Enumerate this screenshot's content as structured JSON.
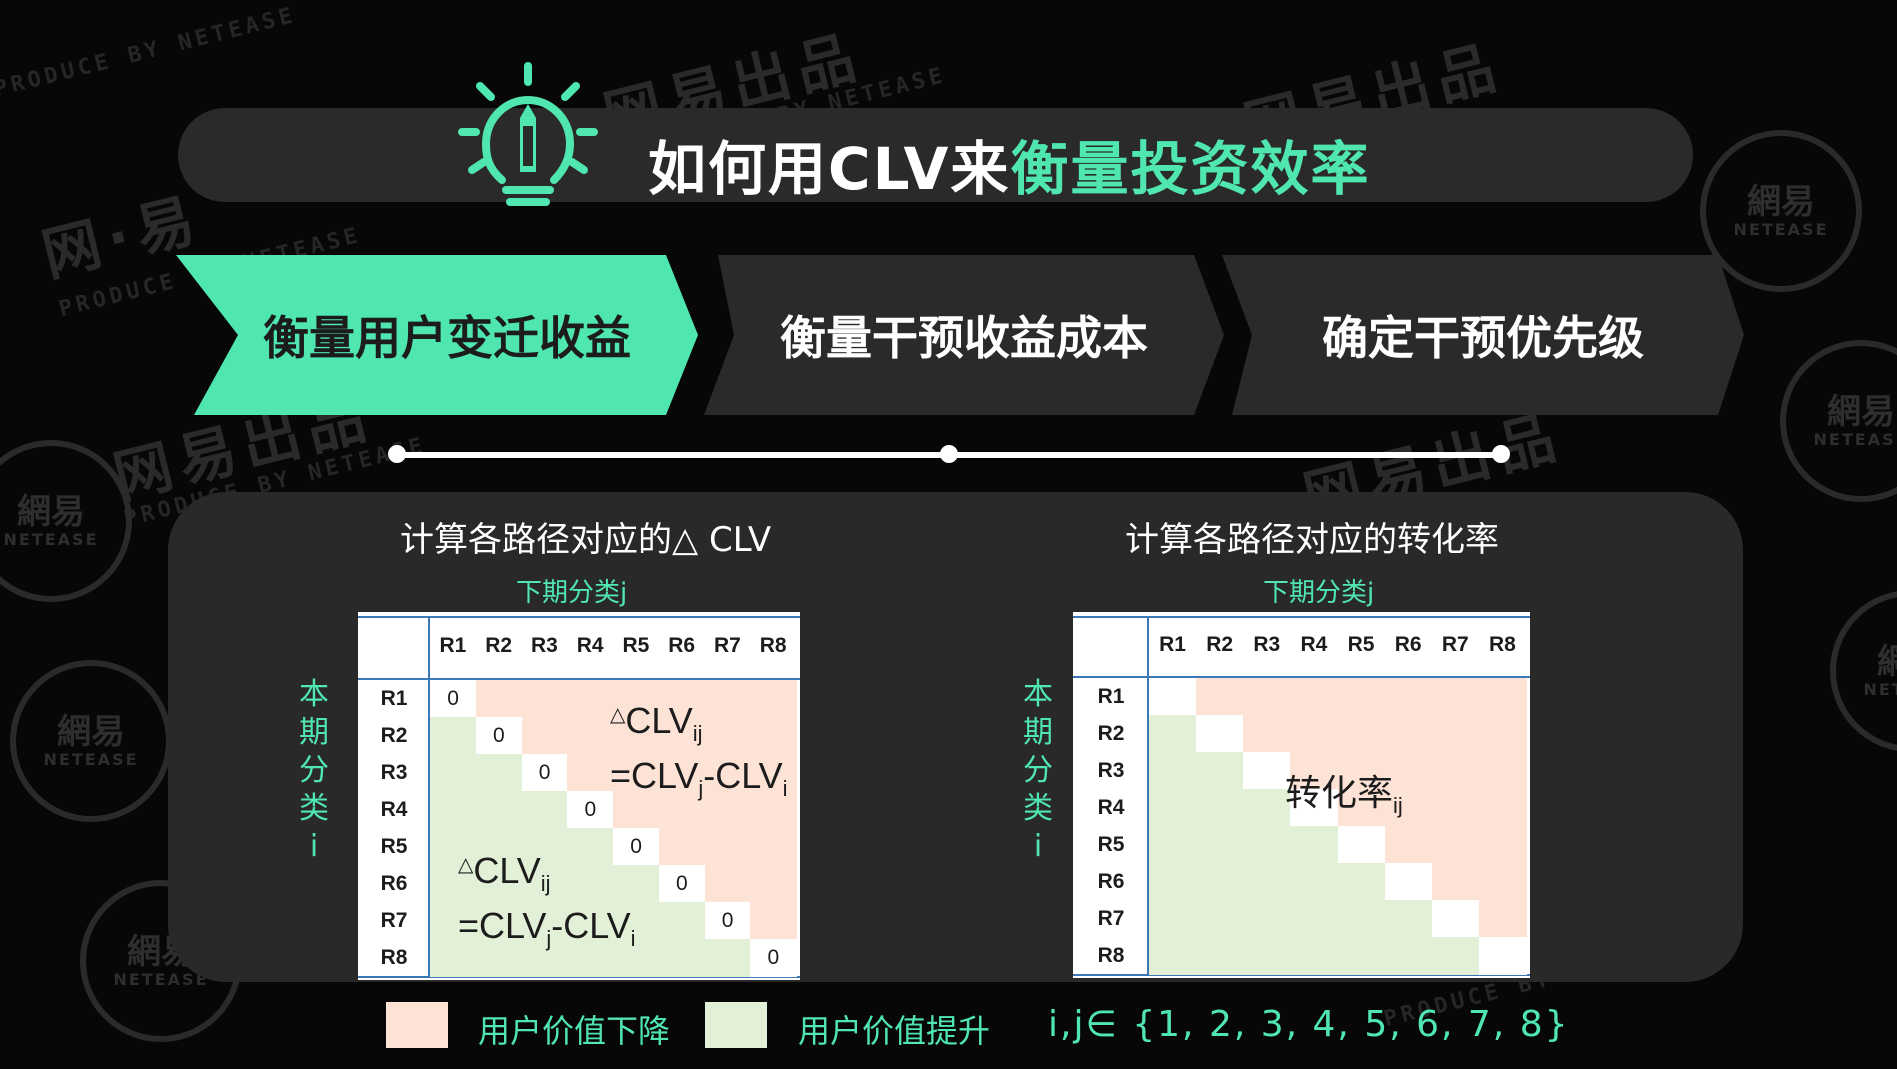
{
  "title": {
    "part1": "如何用CLV来",
    "part2": "衡量投资效率"
  },
  "steps": [
    {
      "label": "衡量用户变迁收益"
    },
    {
      "label": "衡量干预收益成本"
    },
    {
      "label": "确定干预优先级"
    }
  ],
  "watermark": {
    "brand": "网易出品",
    "brand_short": "网·易",
    "produced_by": "PRODUCE BY NETEASE",
    "seal_cn": "網易",
    "seal_en": "NETEASE"
  },
  "left_panel": {
    "title": "计算各路径对应的△ CLV",
    "axis_top": "下期分类j",
    "axis_left": [
      "本",
      "期",
      "分",
      "类",
      "i"
    ],
    "col_headers": [
      "R1",
      "R2",
      "R3",
      "R4",
      "R5",
      "R6",
      "R7",
      "R8"
    ],
    "row_headers": [
      "R1",
      "R2",
      "R3",
      "R4",
      "R5",
      "R6",
      "R7",
      "R8"
    ],
    "diagonal": [
      "0",
      "0",
      "0",
      "0",
      "0",
      "0",
      "0",
      "0"
    ],
    "upper_formula": {
      "delta": "△",
      "line1": "CLV",
      "line1_sub": "ij",
      "line2a": "=CLV",
      "line2_sub_j": "j",
      "line2b": "-CLV",
      "line2_sub_i": "i"
    },
    "lower_formula": {
      "delta": "△",
      "line1": "CLV",
      "line1_sub": "ij",
      "line2a": "=CLV",
      "line2_sub_j": "j",
      "line2b": "-CLV",
      "line2_sub_i": "i"
    }
  },
  "right_panel": {
    "title": "计算各路径对应的转化率",
    "axis_top": "下期分类j",
    "axis_left": [
      "本",
      "期",
      "分",
      "类",
      "i"
    ],
    "col_headers": [
      "R1",
      "R2",
      "R3",
      "R4",
      "R5",
      "R6",
      "R7",
      "R8"
    ],
    "row_headers": [
      "R1",
      "R2",
      "R3",
      "R4",
      "R5",
      "R6",
      "R7",
      "R8"
    ],
    "center_label": "转化率",
    "center_label_sub": "ij"
  },
  "legend": {
    "decline": {
      "label": "用户价值下降",
      "color": "#fde3d6"
    },
    "rise": {
      "label": "用户价值提升",
      "color": "#e3f0d8"
    },
    "index_set": "i,j∈ {1, 2, 3, 4, 5, 6, 7, 8}"
  },
  "colors": {
    "accent": "#4fe6b0",
    "panel": "#2a2929",
    "background": "#070707"
  }
}
